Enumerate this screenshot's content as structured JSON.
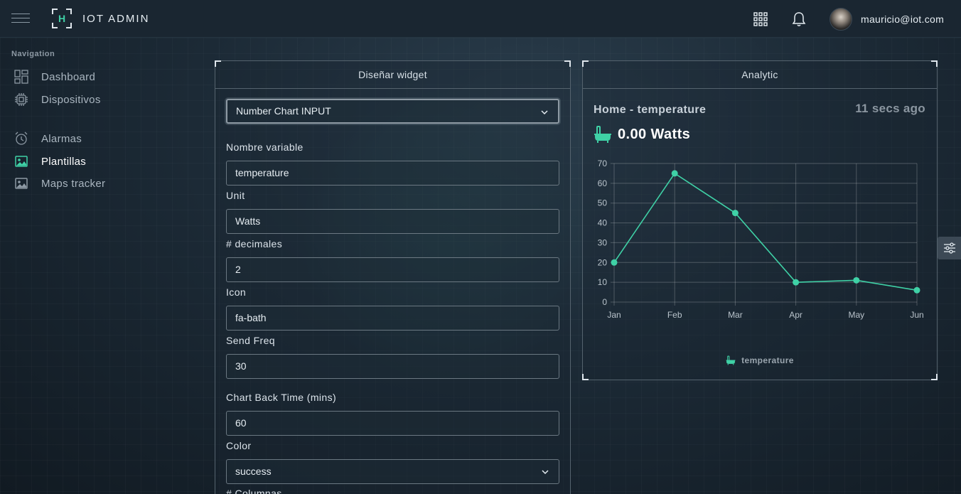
{
  "header": {
    "logo_letter": "H",
    "brand": "IOT ADMIN",
    "user_email": "mauricio@iot.com"
  },
  "sidebar": {
    "title": "Navigation",
    "items": [
      {
        "label": "Dashboard",
        "icon": "dashboard-icon"
      },
      {
        "label": "Dispositivos",
        "icon": "chip-icon"
      },
      {
        "label": "Alarmas",
        "icon": "alarm-clock-icon"
      },
      {
        "label": "Plantillas",
        "icon": "image-icon",
        "active": true
      },
      {
        "label": "Maps tracker",
        "icon": "image-icon"
      }
    ]
  },
  "design_card": {
    "title": "Diseñar widget",
    "widget_type": "Number Chart INPUT",
    "fields": {
      "variable_name": {
        "label": "Nombre variable",
        "value": "temperature"
      },
      "unit": {
        "label": "Unit",
        "value": "Watts"
      },
      "decimals": {
        "label": "# decimales",
        "value": "2"
      },
      "icon": {
        "label": "Icon",
        "value": "fa-bath"
      },
      "send_freq": {
        "label": "Send Freq",
        "value": "30"
      },
      "chart_back_time": {
        "label": "Chart Back Time (mins)",
        "value": "60"
      },
      "color": {
        "label": "Color",
        "value": "success"
      },
      "columns": {
        "label": "# Columnas"
      }
    }
  },
  "analytic_card": {
    "title": "Analytic",
    "widget_title": "Home - temperature",
    "time_ago": "11 secs ago",
    "value_text": "0.00 Watts",
    "icon": "bath-icon",
    "legend": "temperature"
  },
  "colors": {
    "accent": "#3fd1a6",
    "background": "#1c2a36"
  },
  "chart_data": {
    "type": "line",
    "categories": [
      "Jan",
      "Feb",
      "Mar",
      "Apr",
      "May",
      "Jun"
    ],
    "series": [
      {
        "name": "temperature",
        "values": [
          20,
          65,
          45,
          10,
          11,
          6
        ]
      }
    ],
    "ylim": [
      0,
      70
    ],
    "yticks": [
      0,
      10,
      20,
      30,
      40,
      50,
      60,
      70
    ],
    "grid": true,
    "legend_position": "bottom"
  }
}
